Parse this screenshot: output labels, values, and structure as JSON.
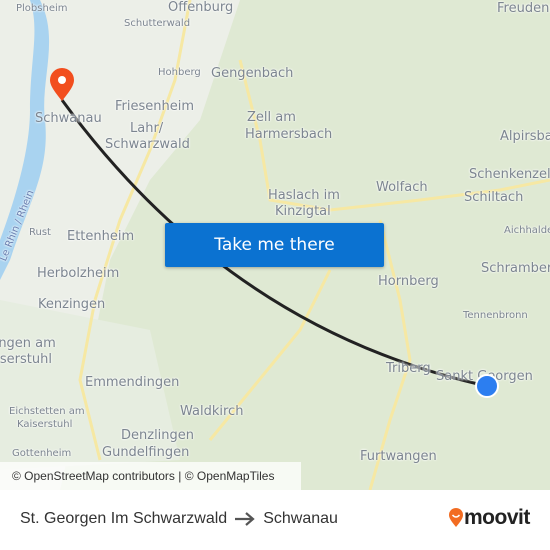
{
  "map": {
    "labels": [
      "Plobsheim",
      "Schutterwald",
      "Hohberg",
      "Gengenbach",
      "Schwanau",
      "Friesenheim",
      "Lahr/",
      "Schwarzwald",
      "Zell am",
      "Harmersbach",
      "Haslach im",
      "Kinzigtal",
      "Wolfach",
      "Freudenstadt",
      "Alpirsbach",
      "Schenkenzell",
      "Schiltach",
      "Aichhalden",
      "Le Rhin / Rhein",
      "Rust",
      "Ettenheim",
      "Herbolzheim",
      "Kenzingen",
      "Endingen am",
      "Kaiserstuhl",
      "Hornberg",
      "Schramberg",
      "Tennenbronn",
      "Triberg",
      "Sankt Georgen",
      "Emmendingen",
      "Waldkirch",
      "Eichstetten am",
      "Kaiserstuhl",
      "Denzlingen",
      "Gundelfingen",
      "Furtwangen",
      "Gottenheim",
      "Offenburg"
    ],
    "origin_marker_color": "#2c7ef0",
    "destination_marker_color": "#f24e1e",
    "route_color": "#222222"
  },
  "cta": {
    "label": "Take me there",
    "color": "#0b72d1"
  },
  "attribution": "© OpenStreetMap contributors | © OpenMapTiles",
  "footer": {
    "from": "St. Georgen Im Schwarzwald",
    "to": "Schwanau",
    "arrow_icon": "arrow-right",
    "brand": "moovit",
    "brand_color": "#f26c22"
  }
}
